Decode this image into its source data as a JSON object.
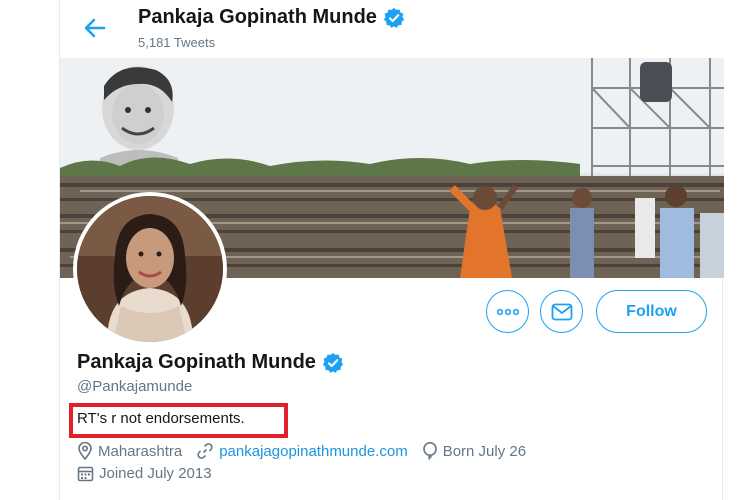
{
  "header": {
    "name": "Pankaja Gopinath Munde",
    "tweets": "5,181 Tweets"
  },
  "profile": {
    "name": "Pankaja Gopinath Munde",
    "handle": "@Pankajamunde",
    "bio": "RT's r not endorsements.",
    "location": "Maharashtra",
    "website": "pankajagopinathmunde.com",
    "birthday": "Born July 26",
    "joined": "Joined July 2013"
  },
  "actions": {
    "follow_label": "Follow"
  },
  "colors": {
    "accent": "#1da1f2",
    "highlight_box": "#e0202a",
    "verified": "#1da1f2"
  },
  "icons": [
    "back-arrow-icon",
    "verified-badge-icon",
    "more-options-icon",
    "message-icon",
    "location-icon",
    "link-icon",
    "birthday-balloon-icon",
    "calendar-icon"
  ]
}
